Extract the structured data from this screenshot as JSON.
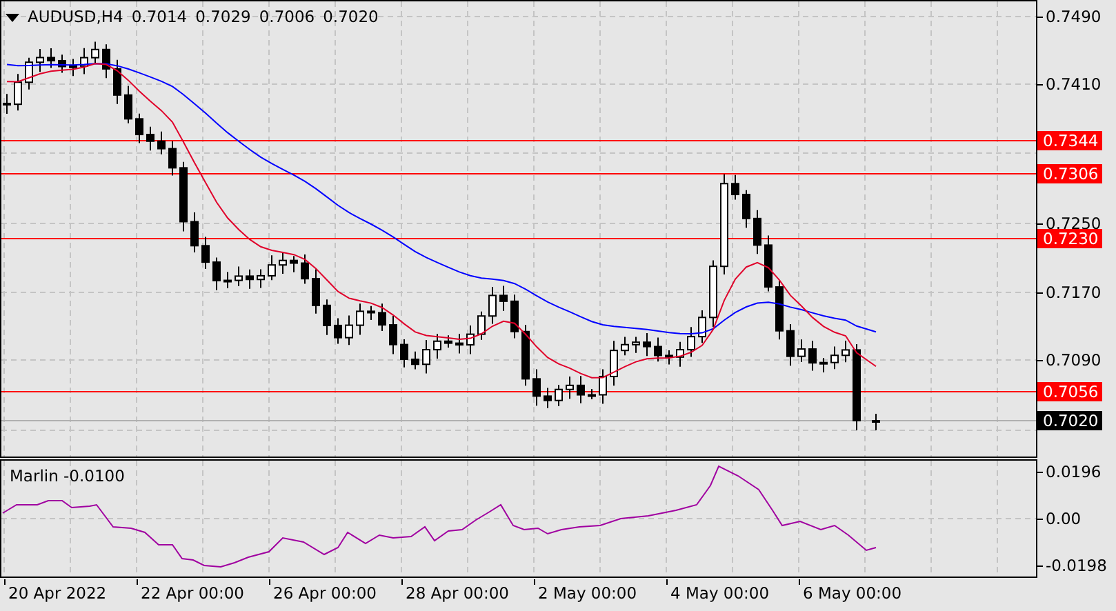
{
  "chart": {
    "symbol": "AUDUSD,H4",
    "ohlc": [
      "0.7014",
      "0.7029",
      "0.7006",
      "0.7020"
    ],
    "price_axis": [
      "0.7490",
      "0.7410",
      "0.7250",
      "0.7170",
      "0.7090"
    ],
    "levels": [
      {
        "label": "0.7344",
        "kind": "resistance"
      },
      {
        "label": "0.7306",
        "kind": "resistance"
      },
      {
        "label": "0.7230",
        "kind": "resistance"
      },
      {
        "label": "0.7056",
        "kind": "resistance"
      },
      {
        "label": "0.7020",
        "kind": "bid"
      }
    ]
  },
  "indicator": {
    "label": "Marlin -0.0100",
    "axis": [
      "0.0196",
      "0.00",
      "-0.0198"
    ]
  },
  "time_axis": [
    "20 Apr 2022",
    "22 Apr 00:00",
    "26 Apr 00:00",
    "28 Apr 00:00",
    "2 May 00:00",
    "4 May 00:00",
    "6 May 00:00"
  ]
}
